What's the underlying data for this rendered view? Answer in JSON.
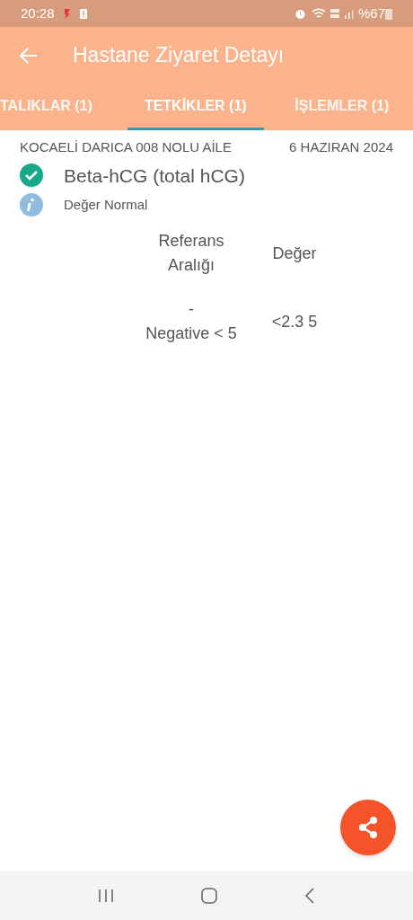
{
  "status_bar": {
    "time": "20:28",
    "battery": "%67"
  },
  "app_bar": {
    "title": "Hastane Ziyaret Detayı"
  },
  "tabs": [
    {
      "label": "TALIKLAR (1)",
      "selected": false
    },
    {
      "label": "TETKİKLER (1)",
      "selected": true
    },
    {
      "label": "İŞLEMLER (1)",
      "selected": false
    }
  ],
  "result": {
    "facility": "KOCAELİ DARICA 008 NOLU AİLE",
    "date": "6 HAZIRAN 2024",
    "test_name": "Beta-hCG (total hCG)",
    "note": "Değer Normal",
    "table": {
      "columns": [
        "Referans\nAralığı",
        "Değer"
      ],
      "rows": [
        [
          "-\nNegative < 5",
          "<2.3 5"
        ]
      ]
    }
  }
}
